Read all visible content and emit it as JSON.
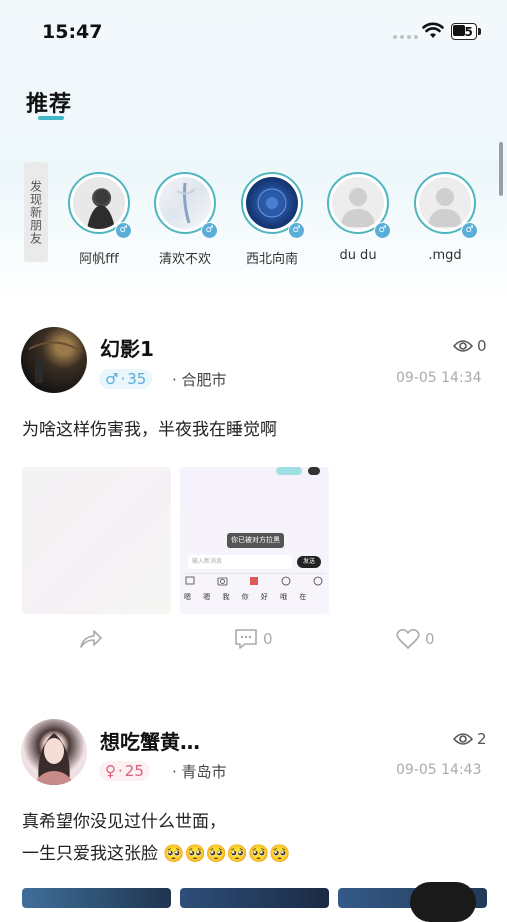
{
  "status_bar": {
    "time": "15:47",
    "battery": "55"
  },
  "header": {
    "title": "推荐"
  },
  "discover": {
    "label": "发现新朋友",
    "friends": [
      {
        "name": "阿帆fff",
        "gender": "♂"
      },
      {
        "name": "清欢不欢",
        "gender": "♂"
      },
      {
        "name": "西北向南",
        "gender": "♂"
      },
      {
        "name": "du du",
        "gender": "♂"
      },
      {
        "name": ".mgd",
        "gender": "♂"
      }
    ]
  },
  "posts": [
    {
      "username": "幻影1",
      "views": "0",
      "gender": "♂",
      "age": "35",
      "city": "合肥市",
      "time": "09-05 14:34",
      "content": "为啥这样伤害我，半夜我在睡觉啊",
      "comments": "0",
      "likes": "0",
      "screenshot": {
        "popup": "你已被对方拉黑",
        "input_placeholder": "输入新消息",
        "send": "发送",
        "shortcuts": "嗯 嗯 我 你 好 哦 在"
      }
    },
    {
      "username": "想吃蟹黄…",
      "views": "2",
      "gender": "♀",
      "age": "25",
      "city": "青岛市",
      "time": "09-05 14:43",
      "content_line1": "真希望你没见过什么世面，",
      "content_line2": "一生只爱我这张脸 🥺🥺🥺🥺🥺🥺"
    }
  ],
  "colors": {
    "accent": "#41b7c8",
    "male": "#5aaed8",
    "female": "#d9607d"
  }
}
